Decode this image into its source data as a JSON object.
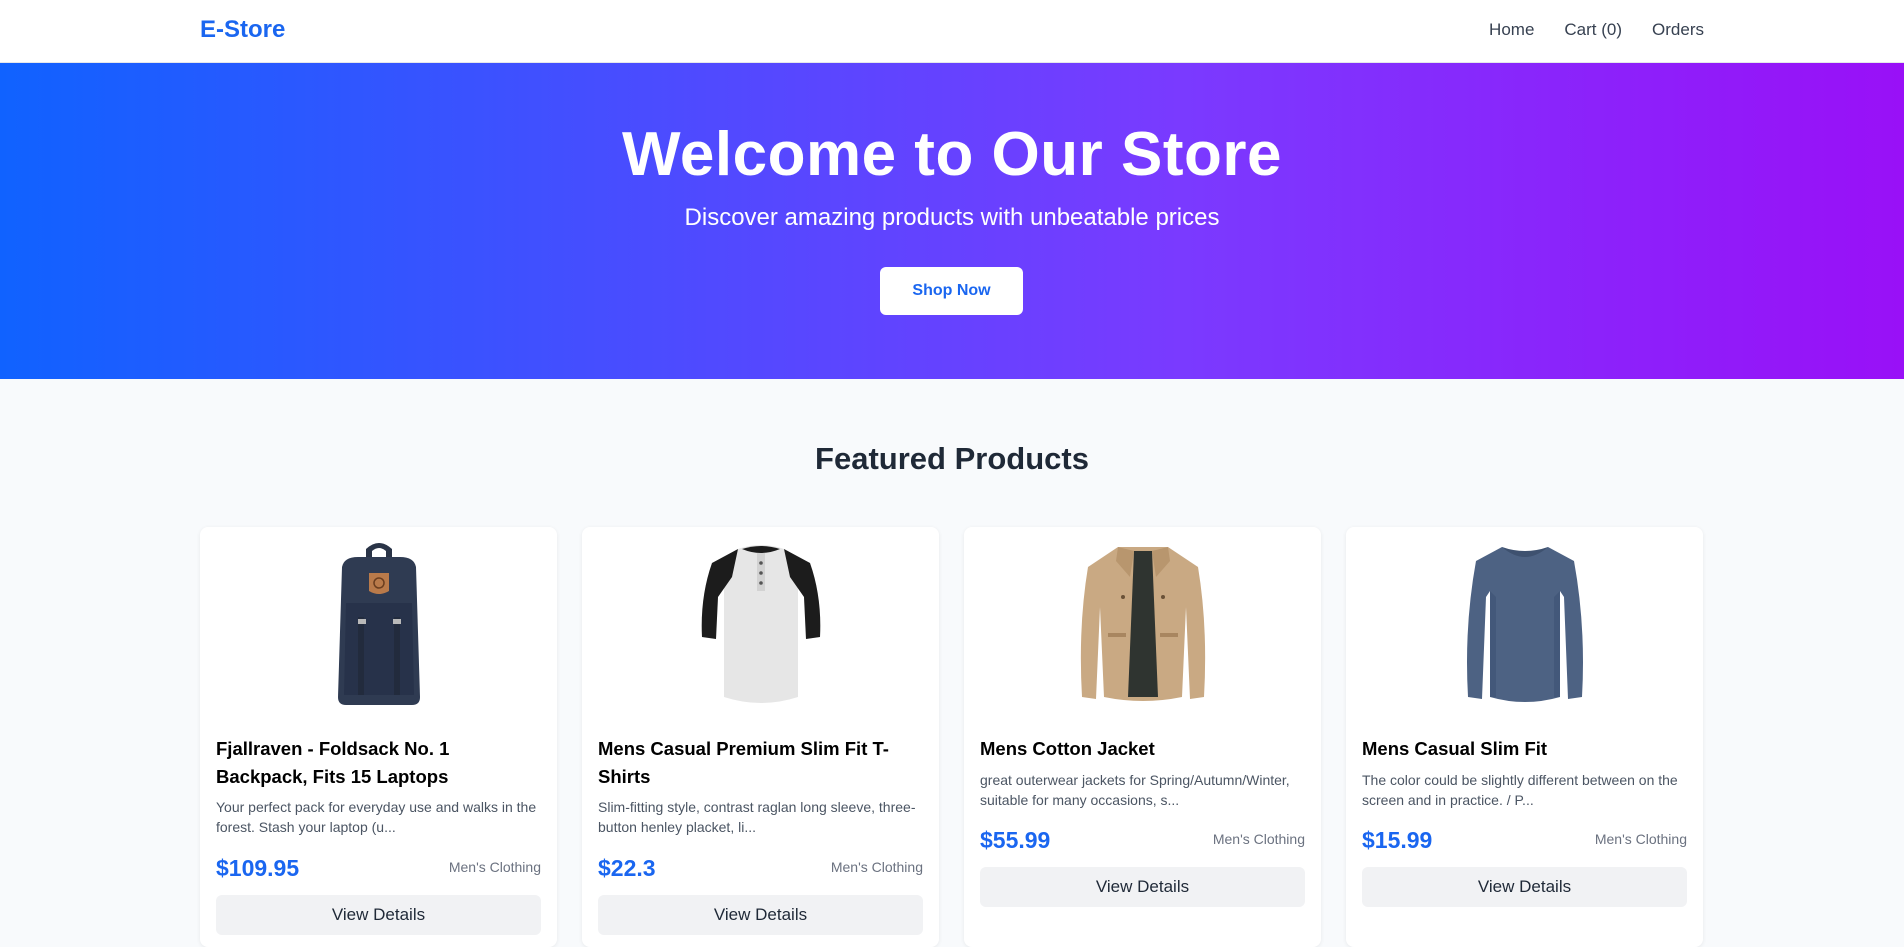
{
  "nav": {
    "brand": "E-Store",
    "links": [
      "Home",
      "Cart (0)",
      "Orders"
    ]
  },
  "hero": {
    "title": "Welcome to Our Store",
    "subtitle": "Discover amazing products with unbeatable prices",
    "cta": "Shop Now"
  },
  "section": {
    "title": "Featured Products"
  },
  "products": [
    {
      "title": "Fjallraven - Foldsack No. 1 Backpack, Fits 15 Laptops",
      "description": "Your perfect pack for everyday use and walks in the forest. Stash your laptop (u...",
      "price": "$109.95",
      "category": "Men's Clothing",
      "button": "View Details",
      "icon": "backpack-image"
    },
    {
      "title": "Mens Casual Premium Slim Fit T-Shirts",
      "description": "Slim-fitting style, contrast raglan long sleeve, three-button henley placket, li...",
      "price": "$22.3",
      "category": "Men's Clothing",
      "button": "View Details",
      "icon": "tshirt-image"
    },
    {
      "title": "Mens Cotton Jacket",
      "description": "great outerwear jackets for Spring/Autumn/Winter, suitable for many occasions, s...",
      "price": "$55.99",
      "category": "Men's Clothing",
      "button": "View Details",
      "icon": "jacket-image"
    },
    {
      "title": "Mens Casual Slim Fit",
      "description": "The color could be slightly different between on the screen and in practice. / P...",
      "price": "$15.99",
      "category": "Men's Clothing",
      "button": "View Details",
      "icon": "longsleeve-image"
    }
  ],
  "colors": {
    "accent": "#1a66f0",
    "hero_start": "#1062ff",
    "hero_end": "#9910f7"
  }
}
